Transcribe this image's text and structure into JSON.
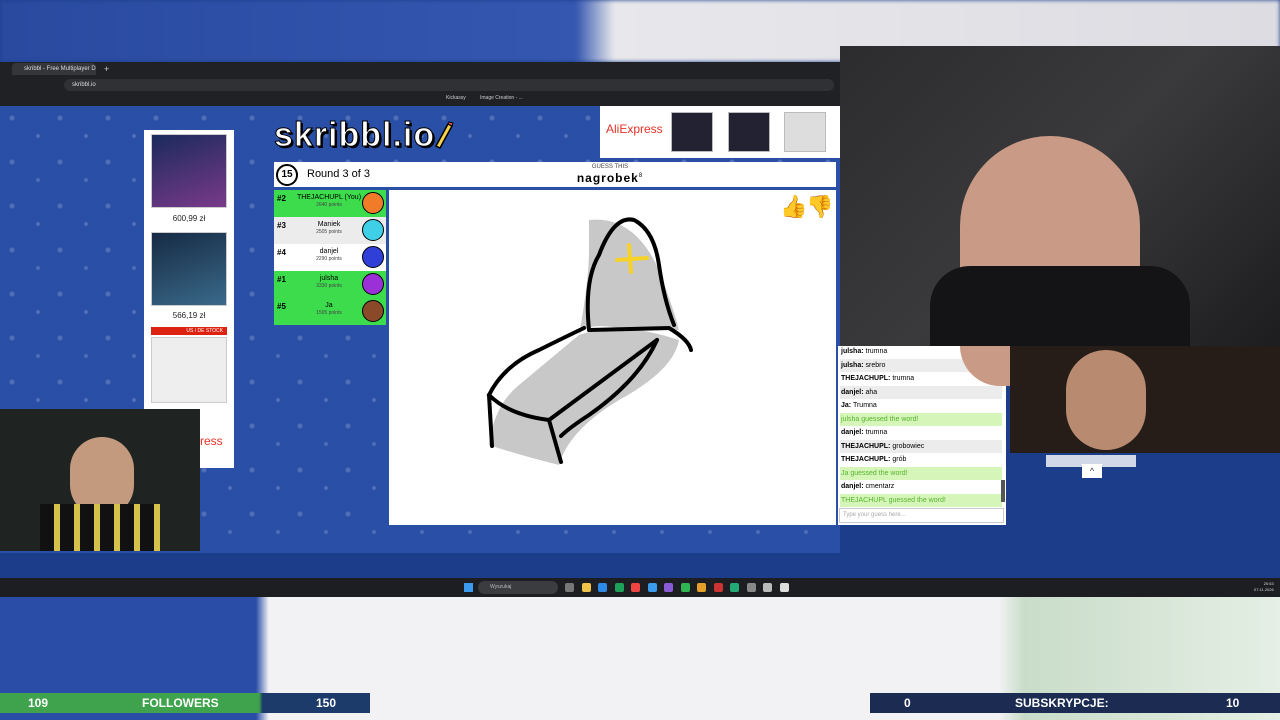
{
  "browser": {
    "tab_title": "skribbl - Free Multiplayer Draw...",
    "new_tab_label": "+",
    "url": "skribbl.io",
    "bookmarks": [
      "Kickassy",
      "Image Creation - ..."
    ]
  },
  "ads": {
    "left_prices": [
      "600,99 zł",
      "566,19 zł"
    ],
    "left_badge": "US / DE STOCK",
    "left_brand_cut": "ress",
    "top_brand": "AliExpress"
  },
  "game": {
    "logo": "skribbl.io",
    "timer": "15",
    "round": "Round 3 of 3",
    "guess_label": "GUESS THIS",
    "word": "nagrobek",
    "word_length": "8"
  },
  "players": [
    {
      "rank": "#2",
      "name": "THEJACHUPL (You)",
      "points": "2640 points",
      "color": "#3ddc4d",
      "avatar": "#f07c2a"
    },
    {
      "rank": "#3",
      "name": "Maniek",
      "points": "2505 points",
      "color": "#ececec",
      "avatar": "#3fd0e8"
    },
    {
      "rank": "#4",
      "name": "danjel",
      "points": "2290 points",
      "color": "#ffffff",
      "avatar": "#2f3fd8"
    },
    {
      "rank": "#1",
      "name": "julsha",
      "points": "3330 points",
      "color": "#3ddc4d",
      "avatar": "#9b2fd8"
    },
    {
      "rank": "#5",
      "name": "Ja",
      "points": "1505 points",
      "color": "#3ddc4d",
      "avatar": "#8a4a2a"
    }
  ],
  "chat": {
    "messages": [
      {
        "who": "julsha:",
        "text": "trumna",
        "kind": "normal"
      },
      {
        "who": "julsha:",
        "text": "srebro",
        "kind": "alt"
      },
      {
        "who": "THEJACHUPL:",
        "text": "trumna",
        "kind": "normal"
      },
      {
        "who": "danjel:",
        "text": "aha",
        "kind": "alt"
      },
      {
        "who": "Ja:",
        "text": "Trumna",
        "kind": "normal"
      },
      {
        "who": "",
        "text": "julsha guessed the word!",
        "kind": "ok"
      },
      {
        "who": "danjel:",
        "text": "trumna",
        "kind": "normal"
      },
      {
        "who": "THEJACHUPL:",
        "text": "grobowiec",
        "kind": "alt"
      },
      {
        "who": "THEJACHUPL:",
        "text": "grób",
        "kind": "normal"
      },
      {
        "who": "",
        "text": "Ja guessed the word!",
        "kind": "ok"
      },
      {
        "who": "danjel:",
        "text": "cmentarz",
        "kind": "normal"
      },
      {
        "who": "",
        "text": "THEJACHUPL guessed the word!",
        "kind": "ok"
      }
    ],
    "input_placeholder": "Type your guess here..."
  },
  "taskbar": {
    "search_label": "Wyszukaj",
    "time": "20:53",
    "date": "07.11.2026"
  },
  "overlay": {
    "followers_current": "109",
    "followers_label": "FOLLOWERS",
    "followers_goal": "150",
    "subs_current": "0",
    "subs_label": "SUBSKRYPCJE:",
    "subs_goal": "10"
  },
  "colors": {
    "accent": "#3ddc4d",
    "page_blue": "#2a4fa6",
    "ok_green": "#55b52f"
  }
}
